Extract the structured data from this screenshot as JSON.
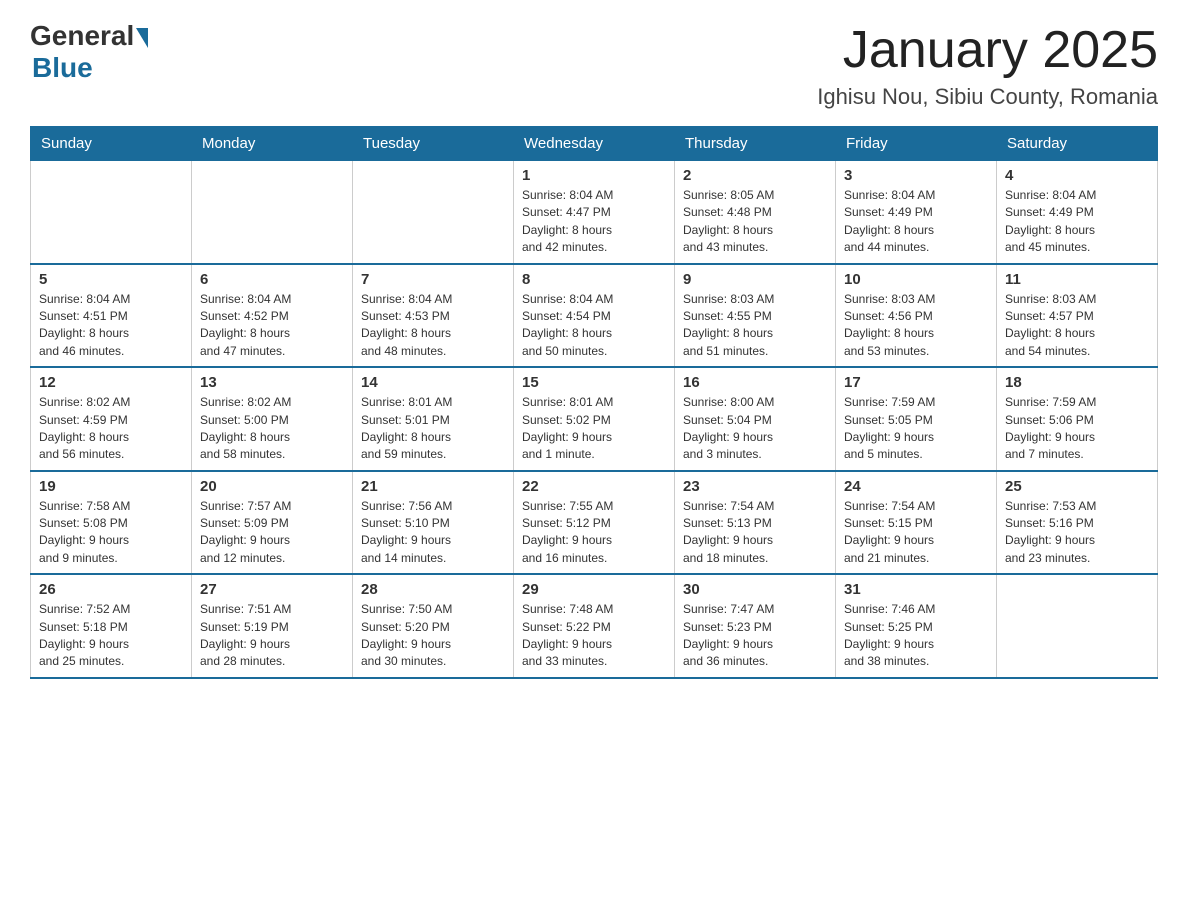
{
  "header": {
    "title": "January 2025",
    "location": "Ighisu Nou, Sibiu County, Romania",
    "logo_general": "General",
    "logo_blue": "Blue"
  },
  "days_of_week": [
    "Sunday",
    "Monday",
    "Tuesday",
    "Wednesday",
    "Thursday",
    "Friday",
    "Saturday"
  ],
  "weeks": [
    [
      {
        "num": "",
        "info": ""
      },
      {
        "num": "",
        "info": ""
      },
      {
        "num": "",
        "info": ""
      },
      {
        "num": "1",
        "info": "Sunrise: 8:04 AM\nSunset: 4:47 PM\nDaylight: 8 hours\nand 42 minutes."
      },
      {
        "num": "2",
        "info": "Sunrise: 8:05 AM\nSunset: 4:48 PM\nDaylight: 8 hours\nand 43 minutes."
      },
      {
        "num": "3",
        "info": "Sunrise: 8:04 AM\nSunset: 4:49 PM\nDaylight: 8 hours\nand 44 minutes."
      },
      {
        "num": "4",
        "info": "Sunrise: 8:04 AM\nSunset: 4:49 PM\nDaylight: 8 hours\nand 45 minutes."
      }
    ],
    [
      {
        "num": "5",
        "info": "Sunrise: 8:04 AM\nSunset: 4:51 PM\nDaylight: 8 hours\nand 46 minutes."
      },
      {
        "num": "6",
        "info": "Sunrise: 8:04 AM\nSunset: 4:52 PM\nDaylight: 8 hours\nand 47 minutes."
      },
      {
        "num": "7",
        "info": "Sunrise: 8:04 AM\nSunset: 4:53 PM\nDaylight: 8 hours\nand 48 minutes."
      },
      {
        "num": "8",
        "info": "Sunrise: 8:04 AM\nSunset: 4:54 PM\nDaylight: 8 hours\nand 50 minutes."
      },
      {
        "num": "9",
        "info": "Sunrise: 8:03 AM\nSunset: 4:55 PM\nDaylight: 8 hours\nand 51 minutes."
      },
      {
        "num": "10",
        "info": "Sunrise: 8:03 AM\nSunset: 4:56 PM\nDaylight: 8 hours\nand 53 minutes."
      },
      {
        "num": "11",
        "info": "Sunrise: 8:03 AM\nSunset: 4:57 PM\nDaylight: 8 hours\nand 54 minutes."
      }
    ],
    [
      {
        "num": "12",
        "info": "Sunrise: 8:02 AM\nSunset: 4:59 PM\nDaylight: 8 hours\nand 56 minutes."
      },
      {
        "num": "13",
        "info": "Sunrise: 8:02 AM\nSunset: 5:00 PM\nDaylight: 8 hours\nand 58 minutes."
      },
      {
        "num": "14",
        "info": "Sunrise: 8:01 AM\nSunset: 5:01 PM\nDaylight: 8 hours\nand 59 minutes."
      },
      {
        "num": "15",
        "info": "Sunrise: 8:01 AM\nSunset: 5:02 PM\nDaylight: 9 hours\nand 1 minute."
      },
      {
        "num": "16",
        "info": "Sunrise: 8:00 AM\nSunset: 5:04 PM\nDaylight: 9 hours\nand 3 minutes."
      },
      {
        "num": "17",
        "info": "Sunrise: 7:59 AM\nSunset: 5:05 PM\nDaylight: 9 hours\nand 5 minutes."
      },
      {
        "num": "18",
        "info": "Sunrise: 7:59 AM\nSunset: 5:06 PM\nDaylight: 9 hours\nand 7 minutes."
      }
    ],
    [
      {
        "num": "19",
        "info": "Sunrise: 7:58 AM\nSunset: 5:08 PM\nDaylight: 9 hours\nand 9 minutes."
      },
      {
        "num": "20",
        "info": "Sunrise: 7:57 AM\nSunset: 5:09 PM\nDaylight: 9 hours\nand 12 minutes."
      },
      {
        "num": "21",
        "info": "Sunrise: 7:56 AM\nSunset: 5:10 PM\nDaylight: 9 hours\nand 14 minutes."
      },
      {
        "num": "22",
        "info": "Sunrise: 7:55 AM\nSunset: 5:12 PM\nDaylight: 9 hours\nand 16 minutes."
      },
      {
        "num": "23",
        "info": "Sunrise: 7:54 AM\nSunset: 5:13 PM\nDaylight: 9 hours\nand 18 minutes."
      },
      {
        "num": "24",
        "info": "Sunrise: 7:54 AM\nSunset: 5:15 PM\nDaylight: 9 hours\nand 21 minutes."
      },
      {
        "num": "25",
        "info": "Sunrise: 7:53 AM\nSunset: 5:16 PM\nDaylight: 9 hours\nand 23 minutes."
      }
    ],
    [
      {
        "num": "26",
        "info": "Sunrise: 7:52 AM\nSunset: 5:18 PM\nDaylight: 9 hours\nand 25 minutes."
      },
      {
        "num": "27",
        "info": "Sunrise: 7:51 AM\nSunset: 5:19 PM\nDaylight: 9 hours\nand 28 minutes."
      },
      {
        "num": "28",
        "info": "Sunrise: 7:50 AM\nSunset: 5:20 PM\nDaylight: 9 hours\nand 30 minutes."
      },
      {
        "num": "29",
        "info": "Sunrise: 7:48 AM\nSunset: 5:22 PM\nDaylight: 9 hours\nand 33 minutes."
      },
      {
        "num": "30",
        "info": "Sunrise: 7:47 AM\nSunset: 5:23 PM\nDaylight: 9 hours\nand 36 minutes."
      },
      {
        "num": "31",
        "info": "Sunrise: 7:46 AM\nSunset: 5:25 PM\nDaylight: 9 hours\nand 38 minutes."
      },
      {
        "num": "",
        "info": ""
      }
    ]
  ]
}
